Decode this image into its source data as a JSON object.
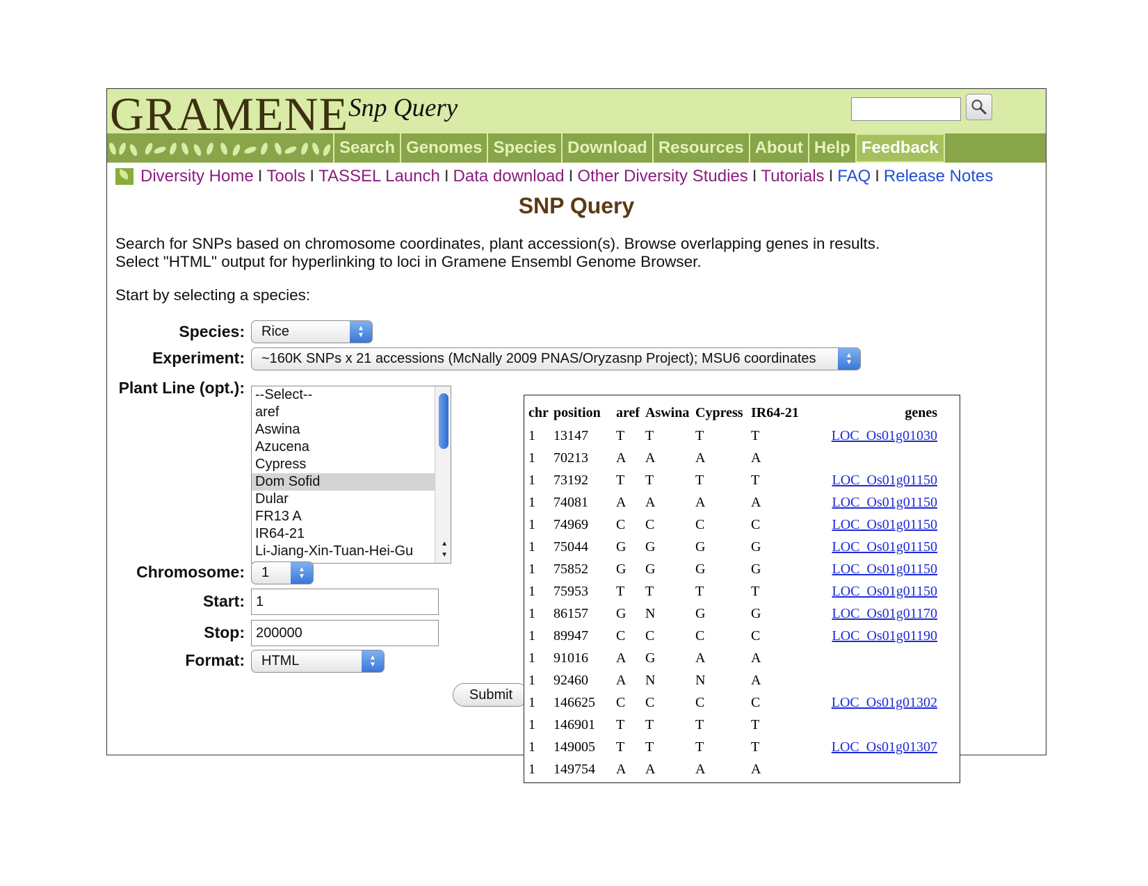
{
  "header": {
    "logo": "GRAMENE",
    "section_title": "Snp Query",
    "search_placeholder": ""
  },
  "nav": {
    "tabs": [
      "Search",
      "Genomes",
      "Species",
      "Download",
      "Resources",
      "About",
      "Help",
      "Feedback"
    ],
    "active_tab": "Feedback"
  },
  "subnav": {
    "links": [
      {
        "label": "Diversity Home",
        "color": "#8b1c80"
      },
      {
        "label": "Tools",
        "color": "#8b1c80"
      },
      {
        "label": "TASSEL Launch",
        "color": "#8b1c80"
      },
      {
        "label": "Data download",
        "color": "#8b1c80"
      },
      {
        "label": "Other Diversity Studies",
        "color": "#8b1c80"
      },
      {
        "label": "Tutorials",
        "color": "#8b1c80"
      },
      {
        "label": "FAQ",
        "color": "#1d4fd6"
      },
      {
        "label": "Release Notes",
        "color": "#1d4fd6"
      }
    ],
    "separator": "I"
  },
  "page": {
    "heading": "SNP Query",
    "intro_line1": "Search for SNPs based on chromosome coordinates, plant accession(s). Browse overlapping genes in results.",
    "intro_line2": "Select \"HTML\" output for hyperlinking to loci in Gramene Ensembl Genome Browser.",
    "start_prompt": "Start by selecting a species:"
  },
  "form": {
    "species_label": "Species:",
    "species_value": "Rice",
    "experiment_label": "Experiment:",
    "experiment_value": "~160K SNPs x 21 accessions (McNally 2009 PNAS/Oryzasnp Project); MSU6 coordinates",
    "plant_line_label": "Plant Line (opt.):",
    "plant_lines": [
      "--Select--",
      "aref",
      "Aswina",
      "Azucena",
      "Cypress",
      "Dom Sofid",
      "Dular",
      "FR13 A",
      "IR64-21",
      "Li-Jiang-Xin-Tuan-Hei-Gu"
    ],
    "plant_line_selected": "Dom Sofid",
    "chromosome_label": "Chromosome:",
    "chromosome_value": "1",
    "start_label": "Start:",
    "start_value": "1",
    "stop_label": "Stop:",
    "stop_value": "200000",
    "format_label": "Format:",
    "format_value": "HTML",
    "submit_label": "Submit"
  },
  "results": {
    "columns": [
      "chr",
      "position",
      "aref",
      "Aswina",
      "Cypress",
      "IR64-21",
      "genes"
    ],
    "rows": [
      [
        "1",
        "13147",
        "T",
        "T",
        "T",
        "T",
        "LOC_Os01g01030"
      ],
      [
        "1",
        "70213",
        "A",
        "A",
        "A",
        "A",
        ""
      ],
      [
        "1",
        "73192",
        "T",
        "T",
        "T",
        "T",
        "LOC_Os01g01150"
      ],
      [
        "1",
        "74081",
        "A",
        "A",
        "A",
        "A",
        "LOC_Os01g01150"
      ],
      [
        "1",
        "74969",
        "C",
        "C",
        "C",
        "C",
        "LOC_Os01g01150"
      ],
      [
        "1",
        "75044",
        "G",
        "G",
        "G",
        "G",
        "LOC_Os01g01150"
      ],
      [
        "1",
        "75852",
        "G",
        "G",
        "G",
        "G",
        "LOC_Os01g01150"
      ],
      [
        "1",
        "75953",
        "T",
        "T",
        "T",
        "T",
        "LOC_Os01g01150"
      ],
      [
        "1",
        "86157",
        "G",
        "N",
        "G",
        "G",
        "LOC_Os01g01170"
      ],
      [
        "1",
        "89947",
        "C",
        "C",
        "C",
        "C",
        "LOC_Os01g01190"
      ],
      [
        "1",
        "91016",
        "A",
        "G",
        "A",
        "A",
        ""
      ],
      [
        "1",
        "92460",
        "A",
        "N",
        "N",
        "A",
        ""
      ],
      [
        "1",
        "146625",
        "C",
        "C",
        "C",
        "C",
        "LOC_Os01g01302"
      ],
      [
        "1",
        "146901",
        "T",
        "T",
        "T",
        "T",
        ""
      ],
      [
        "1",
        "149005",
        "T",
        "T",
        "T",
        "T",
        "LOC_Os01g01307"
      ],
      [
        "1",
        "149754",
        "A",
        "A",
        "A",
        "A",
        ""
      ]
    ]
  }
}
